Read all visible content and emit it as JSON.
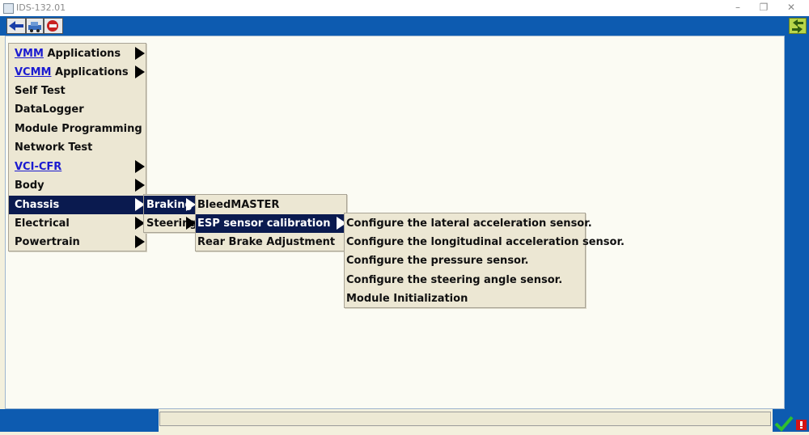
{
  "window": {
    "title": "IDS-132.01"
  },
  "menus": {
    "main": [
      {
        "accent": "VMM",
        "rest": " Applications"
      },
      {
        "accent": "VCMM",
        "rest": " Applications"
      },
      {
        "accent": "",
        "rest": "Self Test"
      },
      {
        "accent": "",
        "rest": "DataLogger"
      },
      {
        "accent": "",
        "rest": "Module Programming"
      },
      {
        "accent": "",
        "rest": "Network Test"
      },
      {
        "accent": "VCI-CFR",
        "rest": ""
      },
      {
        "accent": "",
        "rest": "Body"
      },
      {
        "accent": "",
        "rest": "Chassis"
      },
      {
        "accent": "",
        "rest": "Electrical"
      },
      {
        "accent": "",
        "rest": "Powertrain"
      }
    ],
    "chassis": [
      "Braking",
      "Steering"
    ],
    "braking": [
      "BleedMASTER",
      "ESP sensor calibration",
      "Rear Brake Adjustment"
    ],
    "esp": [
      "Configure the lateral acceleration sensor.",
      "Configure the longitudinal acceleration sensor.",
      "Configure the pressure sensor.",
      "Configure the steering angle sensor.",
      "Module Initialization"
    ]
  },
  "colors": {
    "accent": "#0d5bb0",
    "selection": "#0a1a4f",
    "menu_bg": "#ece7d3",
    "link": "#1b1bd0"
  }
}
